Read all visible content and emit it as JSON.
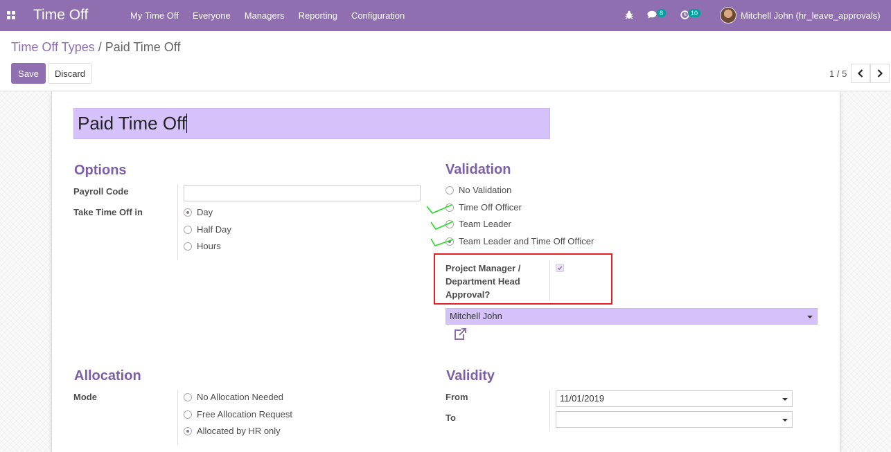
{
  "app": {
    "title": "Time Off"
  },
  "menu": [
    "My Time Off",
    "Everyone",
    "Managers",
    "Reporting",
    "Configuration"
  ],
  "nav": {
    "messages_count": "8",
    "activities_count": "10",
    "user": "Mitchell John (hr_leave_approvals)"
  },
  "breadcrumb": {
    "parent": "Time Off Types",
    "separator": "/",
    "current": "Paid Time Off"
  },
  "buttons": {
    "save": "Save",
    "discard": "Discard"
  },
  "pager": {
    "value": "1 / 5"
  },
  "form": {
    "name": "Paid Time Off",
    "options": {
      "title": "Options",
      "payroll_code_label": "Payroll Code",
      "payroll_code_value": "",
      "take_time_off_label": "Take Time Off in",
      "take_time_off_options": [
        "Day",
        "Half Day",
        "Hours"
      ],
      "take_time_off_selected": "Day"
    },
    "validation": {
      "title": "Validation",
      "options": [
        "No Validation",
        "Time Off Officer",
        "Team Leader",
        "Team Leader and Time Off Officer"
      ],
      "selected": "Team Leader and Time Off Officer",
      "pm_approval_label": "Project Manager / Department Head Approval?",
      "pm_approval_checked": true,
      "responsible": "Mitchell John"
    },
    "allocation": {
      "title": "Allocation",
      "mode_label": "Mode",
      "mode_options": [
        "No Allocation Needed",
        "Free Allocation Request",
        "Allocated by HR only"
      ],
      "mode_selected": "Allocated by HR only"
    },
    "validity": {
      "title": "Validity",
      "from_label": "From",
      "from_value": "11/01/2019",
      "to_label": "To",
      "to_value": ""
    }
  },
  "colors": {
    "brand": "#8f6fb0",
    "highlight": "#d5c2fb",
    "annotation_red": "#e02020",
    "annotation_green": "#22dd22"
  }
}
